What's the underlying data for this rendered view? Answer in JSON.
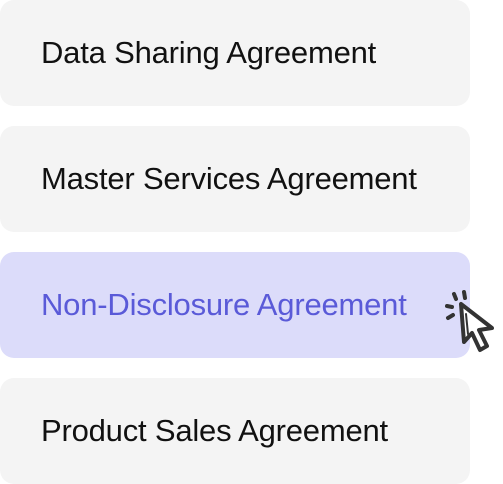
{
  "agreements": {
    "items": [
      {
        "label": "Data Sharing Agreement",
        "selected": false
      },
      {
        "label": "Master Services Agreement",
        "selected": false
      },
      {
        "label": "Non-Disclosure Agreement",
        "selected": true
      },
      {
        "label": "Product Sales Agreement",
        "selected": false
      }
    ]
  },
  "colors": {
    "item_background": "#f4f4f4",
    "selected_background": "#dcdcfa",
    "selected_text": "#5a5ad8",
    "text": "#111111",
    "cursor_stroke": "#333333"
  },
  "icons": {
    "cursor": "pointer-cursor-click-icon"
  }
}
